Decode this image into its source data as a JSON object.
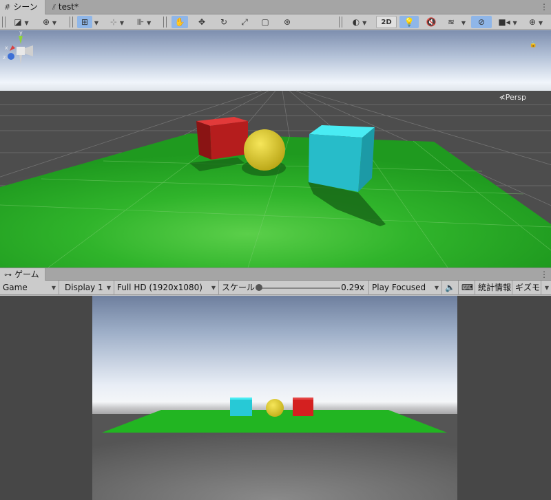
{
  "scene_tabs": {
    "scene_label": "シーン",
    "file_label": "test*"
  },
  "scene_toolbar": {
    "mode_2d": "2D"
  },
  "scene_view": {
    "persp_label": "≮Persp",
    "gizmo_axes": {
      "x": "x",
      "y": "y",
      "z": "z"
    }
  },
  "game_tabs": {
    "game_label": "ゲーム"
  },
  "game_toolbar": {
    "view_select": "Game",
    "display_select": "Display 1",
    "resolution_select": "Full HD (1920x1080)",
    "scale_label": "スケール",
    "scale_value": "0.29x",
    "scale_fraction": 0.03,
    "play_mode_select": "Play Focused",
    "stats_label": "統計情報",
    "gizmos_label": "ギズモ"
  },
  "colors": {
    "ground": "#22b522",
    "red_cube": "#c91d1d",
    "yellow_sphere": "#e9d52a",
    "cyan_cube": "#27c9d6",
    "toolbar_active": "#8fb6e8"
  }
}
